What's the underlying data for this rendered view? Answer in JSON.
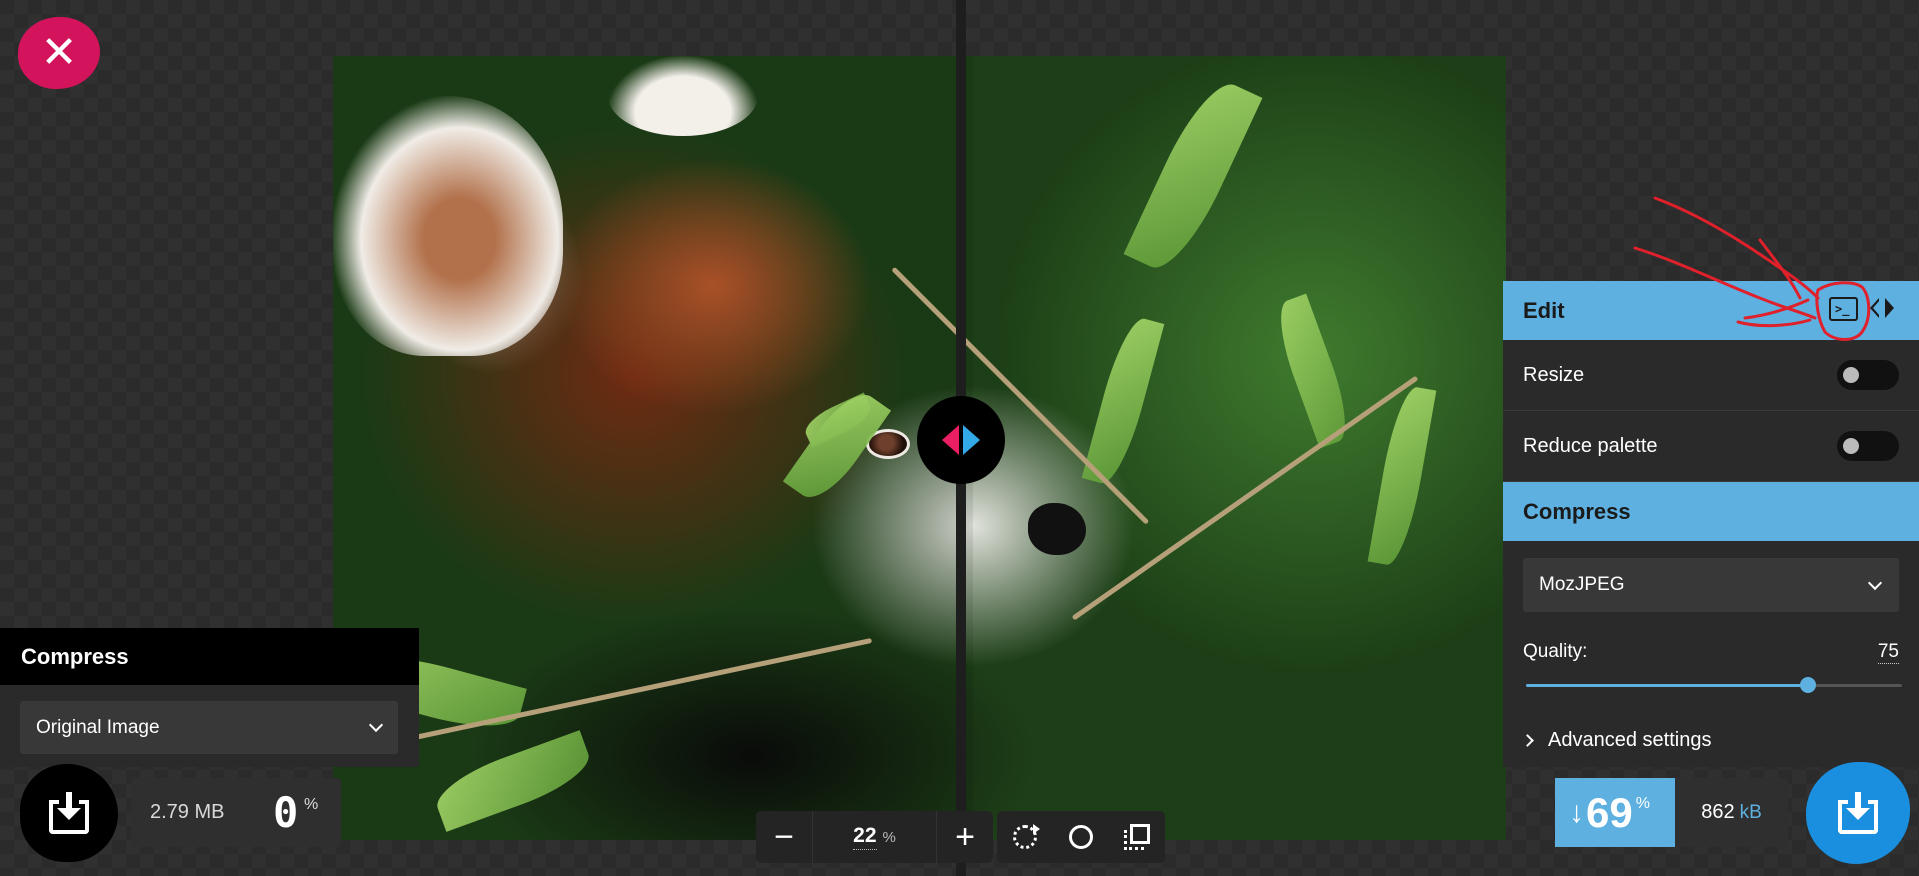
{
  "close_button": {
    "icon": "close-icon",
    "glyph": "✕"
  },
  "left_panel": {
    "header": "Compress",
    "method_select": {
      "selected": "Original Image"
    }
  },
  "left_stats": {
    "size_value": "2.79 MB",
    "percent_value": "0",
    "percent_sign": "%"
  },
  "toolbar": {
    "zoom_out_glyph": "−",
    "zoom_value": "22",
    "zoom_unit": "%",
    "zoom_in_glyph": "+",
    "actions": [
      "rotate-icon",
      "background-toggle-icon",
      "crop-icon"
    ]
  },
  "right_panel": {
    "edit_header": "Edit",
    "edit_icons": [
      "terminal-icon",
      "side-by-side-icon"
    ],
    "resize_label": "Resize",
    "resize_enabled": false,
    "reduce_palette_label": "Reduce palette",
    "reduce_palette_enabled": false,
    "compress_header": "Compress",
    "encoder_select": {
      "selected": "MozJPEG"
    },
    "quality_label": "Quality:",
    "quality_value": "75",
    "quality_fraction": 0.75,
    "advanced_label": "Advanced settings"
  },
  "right_stats": {
    "savings_arrow": "↓",
    "savings_value": "69",
    "savings_sign": "%",
    "size_value": "862",
    "size_unit": "kB"
  },
  "colors": {
    "accent_blue": "#5db0e0",
    "accent_pink": "#d3145c",
    "download_blue": "#1a8fe0",
    "annotation_red": "#e0202a"
  }
}
